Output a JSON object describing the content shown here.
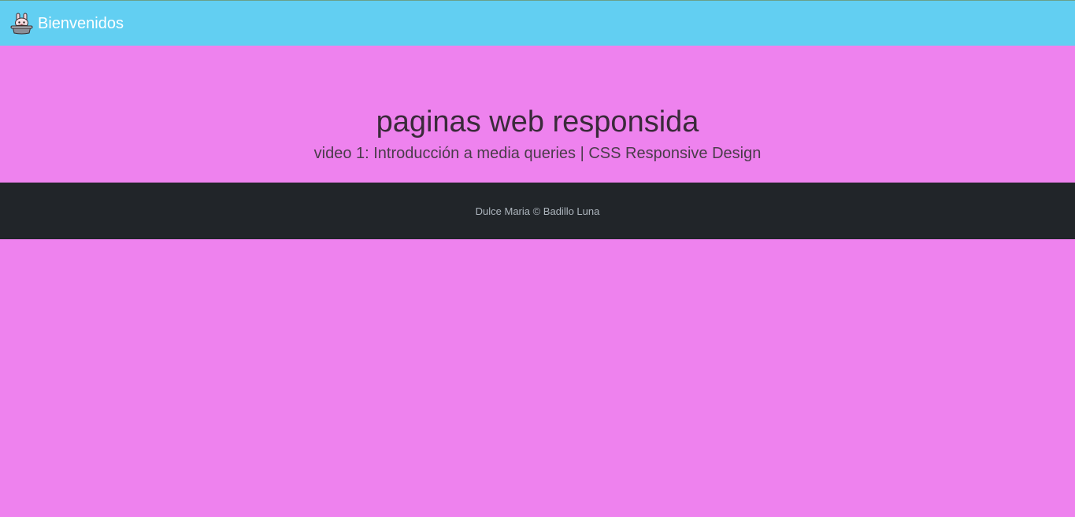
{
  "navbar": {
    "brand_label": "Bienvenidos",
    "logo_icon": "bunny-icon",
    "background_color": "#62cff2"
  },
  "hero": {
    "title": "paginas web responsida",
    "subtitle": "video 1: Introducción a media queries | CSS Responsive Design",
    "background_color": "#ee82ee"
  },
  "footer": {
    "text": "Dulce Maria © Badillo Luna",
    "background_color": "#212529"
  }
}
